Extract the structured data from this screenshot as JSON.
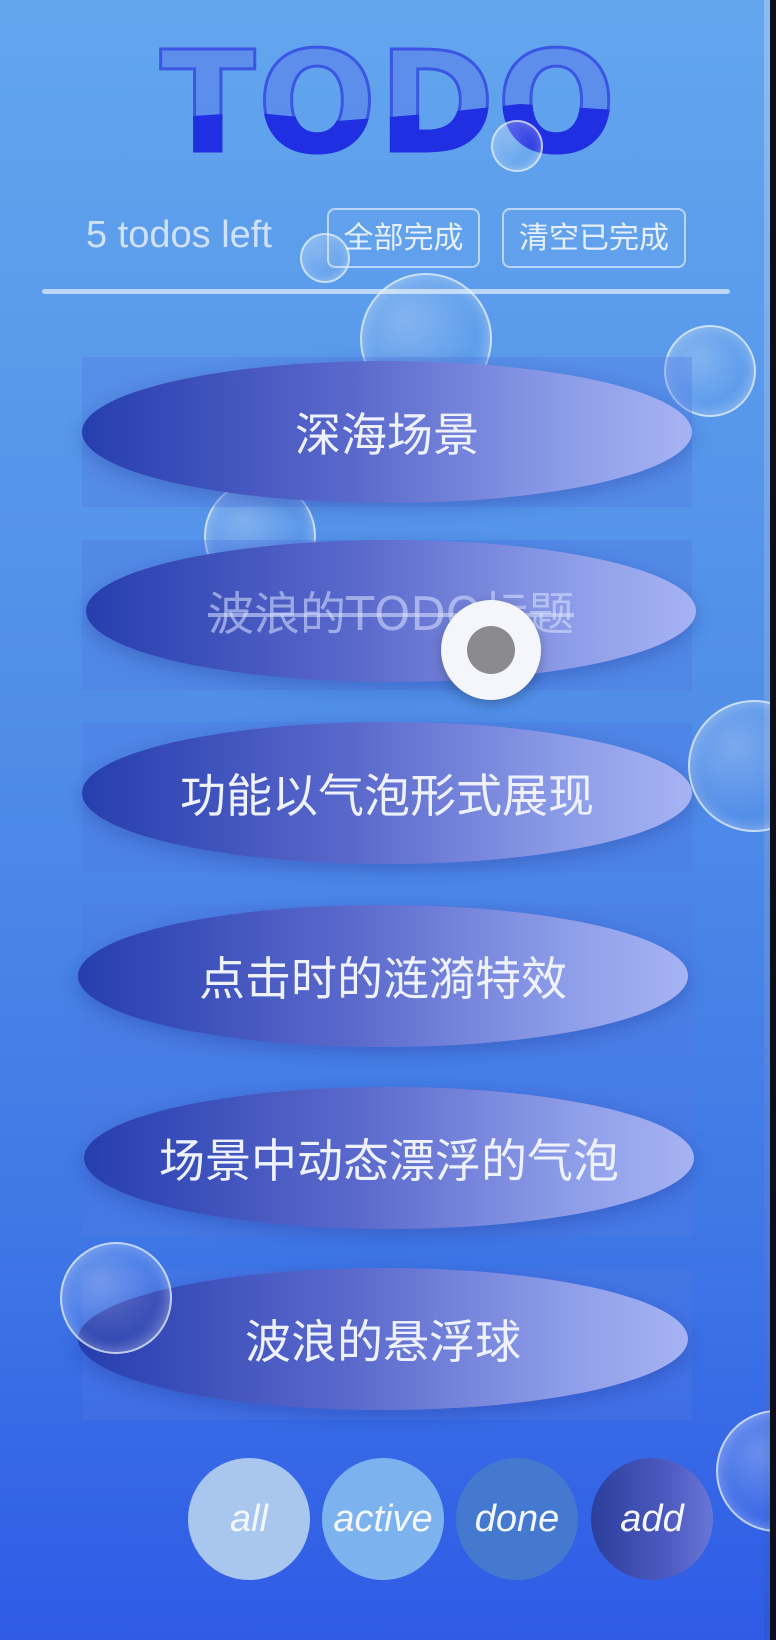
{
  "header": {
    "title": "TODO",
    "count_label": "5 todos left",
    "complete_all_label": "全部完成",
    "clear_completed_label": "清空已完成"
  },
  "todos": [
    {
      "text": "深海场景",
      "completed": false
    },
    {
      "text": "波浪的TODO标题",
      "completed": true
    },
    {
      "text": "功能以气泡形式展现",
      "completed": false
    },
    {
      "text": "点击时的涟漪特效",
      "completed": false
    },
    {
      "text": "场景中动态漂浮的气泡",
      "completed": false
    },
    {
      "text": "波浪的悬浮球",
      "completed": false
    }
  ],
  "filters": {
    "all": "all",
    "active": "active",
    "done": "done",
    "add": "add"
  },
  "colors": {
    "background_top": "#63a6ee",
    "background_bottom": "#2f5be6",
    "title_fill": "#1f2fe1",
    "bubble_gradient_start": "#263eae",
    "bubble_gradient_end": "#a6b3f3"
  }
}
